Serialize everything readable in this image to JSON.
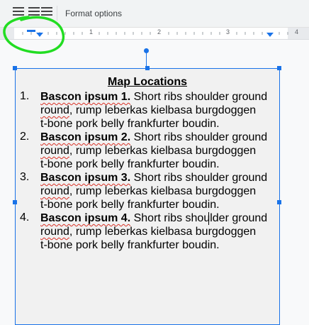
{
  "toolbar": {
    "format_options_label": "Format options"
  },
  "ruler": {
    "numbers": [
      "1",
      "2",
      "3",
      "4"
    ]
  },
  "textbox": {
    "title": "Map Locations",
    "items": [
      {
        "number": "1.",
        "bold": "Bascon ipsum 1.",
        "line1": " Short ribs shoulder ground",
        "line2_a": "round",
        "line2_b": ", rump leberkas kielbasa burgdoggen",
        "line3": "t-bone pork belly frankfurter boudin."
      },
      {
        "number": "2.",
        "bold": "Bascon ipsum 2.",
        "line1": " Short ribs shoulder ground",
        "line2_a": "round",
        "line2_b": ", rump leberkas kielbasa burgdoggen",
        "line3": "t-bone pork belly frankfurter boudin."
      },
      {
        "number": "3.",
        "bold": "Bascon ipsum 3.",
        "line1": " Short ribs shoulder ground",
        "line2_a": "round",
        "line2_b": ", rump leberkas kielbasa burgdoggen",
        "line3": "t-bone pork belly frankfurter boudin."
      },
      {
        "number": "4.",
        "bold": "Bascon ipsum 4.",
        "line1": " Short ribs shoulder ground",
        "line2_a": "round",
        "line2_b": ", rump leberkas kielbasa burgdoggen",
        "line3": "t-bone pork belly frankfurter boudin."
      }
    ]
  },
  "colors": {
    "selection_blue": "#1a73e8",
    "annotation_green": "#22dd22",
    "spellcheck_red": "#d93025"
  }
}
